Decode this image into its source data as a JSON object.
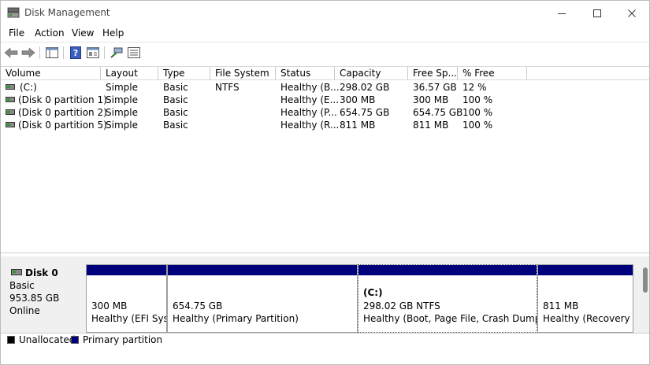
{
  "window": {
    "title": "Disk Management"
  },
  "menu": [
    "File",
    "Action",
    "View",
    "Help"
  ],
  "toolbar": {
    "icons": [
      "back-arrow-icon",
      "forward-arrow-icon",
      "console-tree-icon",
      "help-icon",
      "properties-icon",
      "connect-icon",
      "list-view-icon"
    ]
  },
  "table": {
    "columns": [
      "Volume",
      "Layout",
      "Type",
      "File System",
      "Status",
      "Capacity",
      "Free Sp...",
      "% Free"
    ],
    "rows": [
      {
        "volume": "(C:)",
        "layout": "Simple",
        "type": "Basic",
        "fs": "NTFS",
        "status": "Healthy (B...",
        "capacity": "298.02 GB",
        "free": "36.57 GB",
        "pct": "12 %"
      },
      {
        "volume": "(Disk 0 partition 1)",
        "layout": "Simple",
        "type": "Basic",
        "fs": "",
        "status": "Healthy (E...",
        "capacity": "300 MB",
        "free": "300 MB",
        "pct": "100 %"
      },
      {
        "volume": "(Disk 0 partition 2)",
        "layout": "Simple",
        "type": "Basic",
        "fs": "",
        "status": "Healthy (P...",
        "capacity": "654.75 GB",
        "free": "654.75 GB",
        "pct": "100 %"
      },
      {
        "volume": "(Disk 0 partition 5)",
        "layout": "Simple",
        "type": "Basic",
        "fs": "",
        "status": "Healthy (R...",
        "capacity": "811 MB",
        "free": "811 MB",
        "pct": "100 %"
      }
    ]
  },
  "disk": {
    "name": "Disk 0",
    "type": "Basic",
    "size": "953.85 GB",
    "state": "Online",
    "partitions": [
      {
        "title": "",
        "size": "300 MB",
        "status": "Healthy (EFI System Partition)"
      },
      {
        "title": "",
        "size": "654.75 GB",
        "status": "Healthy (Primary Partition)"
      },
      {
        "title": "(C:)",
        "size": "298.02 GB NTFS",
        "status": "Healthy (Boot, Page File, Crash Dump, Basic Data Partition)"
      },
      {
        "title": "",
        "size": "811 MB",
        "status": "Healthy (Recovery Partition)"
      }
    ]
  },
  "legend": [
    {
      "label": "Unallocated",
      "color": "#000000"
    },
    {
      "label": "Primary partition",
      "color": "#00007c"
    }
  ],
  "colors": {
    "primary": "#00007c",
    "unallocated": "#000000"
  }
}
